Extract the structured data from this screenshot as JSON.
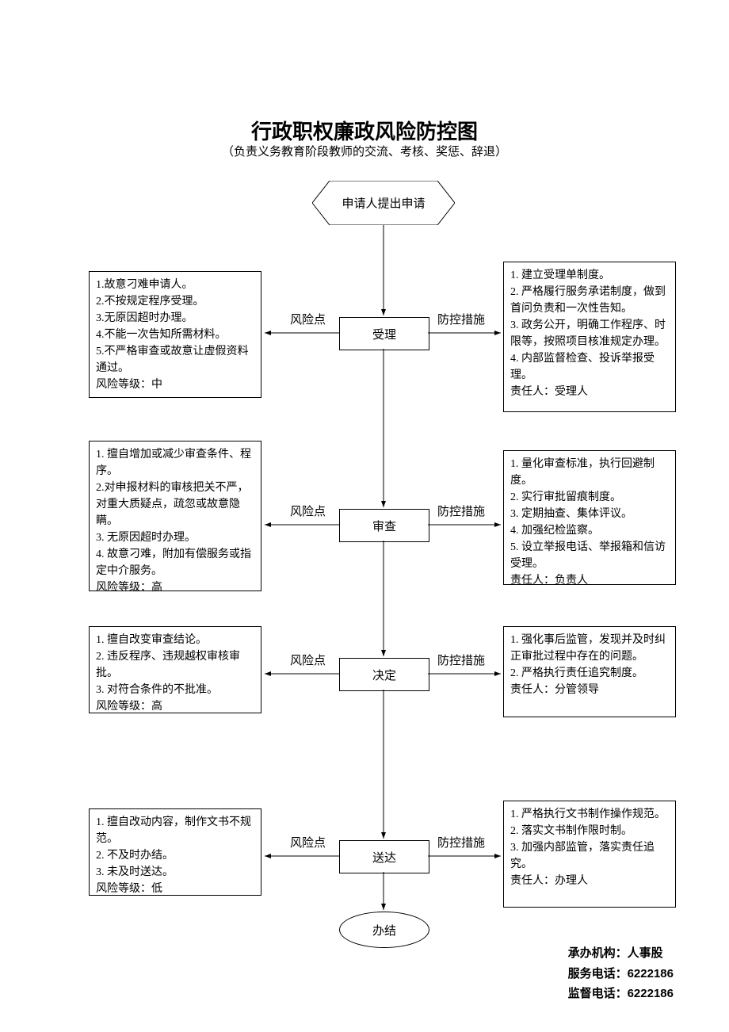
{
  "title": "行政职权廉政风险防控图",
  "subtitle": "（负责义务教育阶段教师的交流、考核、奖惩、辞退）",
  "start": "申请人提出申请",
  "labels": {
    "risk": "风险点",
    "measure": "防控措施"
  },
  "steps": {
    "s1": {
      "name": "受理",
      "risk": "1.故意刁难申请人。\n2.不按规定程序受理。\n3.无原因超时办理。\n4.不能一次告知所需材料。\n5.不严格审查或故意让虚假资料通过。\n风险等级：中",
      "measure": "1. 建立受理单制度。\n2. 严格履行服务承诺制度，做到首问负责和一次性告知。\n3. 政务公开，明确工作程序、时限等，按照项目核准规定办理。\n4. 内部监督检查、投诉举报受理。\n责任人：受理人"
    },
    "s2": {
      "name": "审查",
      "risk": "1. 擅自增加或减少审查条件、程序。\n2.对申报材料的审核把关不严，对重大质疑点，疏忽或故意隐瞒。\n3. 无原因超时办理。\n4. 故意刁难，附加有偿服务或指定中介服务。\n风险等级：高",
      "measure": "1. 量化审查标准，执行回避制度。\n2. 实行审批留痕制度。\n3. 定期抽查、集体评议。\n4. 加强纪检监察。\n5. 设立举报电话、举报箱和信访受理。\n责任人：负责人"
    },
    "s3": {
      "name": "决定",
      "risk": "1. 擅自改变审查结论。\n2. 违反程序、违规越权审核审批。\n3. 对符合条件的不批准。\n风险等级：高",
      "measure": "1. 强化事后监管，发现并及时纠正审批过程中存在的问题。\n2. 严格执行责任追究制度。\n责任人：分管领导"
    },
    "s4": {
      "name": "送达",
      "risk": "1. 擅自改动内容，制作文书不规范。\n2. 不及时办结。\n3. 未及时送达。\n风险等级：低",
      "measure": "1. 严格执行文书制作操作规范。\n2. 落实文书制作限时制。\n3. 加强内部监管，落实责任追究。\n责任人：办理人"
    }
  },
  "end": "办结",
  "footer": {
    "org": "承办机构：人事股",
    "service": "服务电话：6222186",
    "supervise": "监督电话：6222186"
  }
}
